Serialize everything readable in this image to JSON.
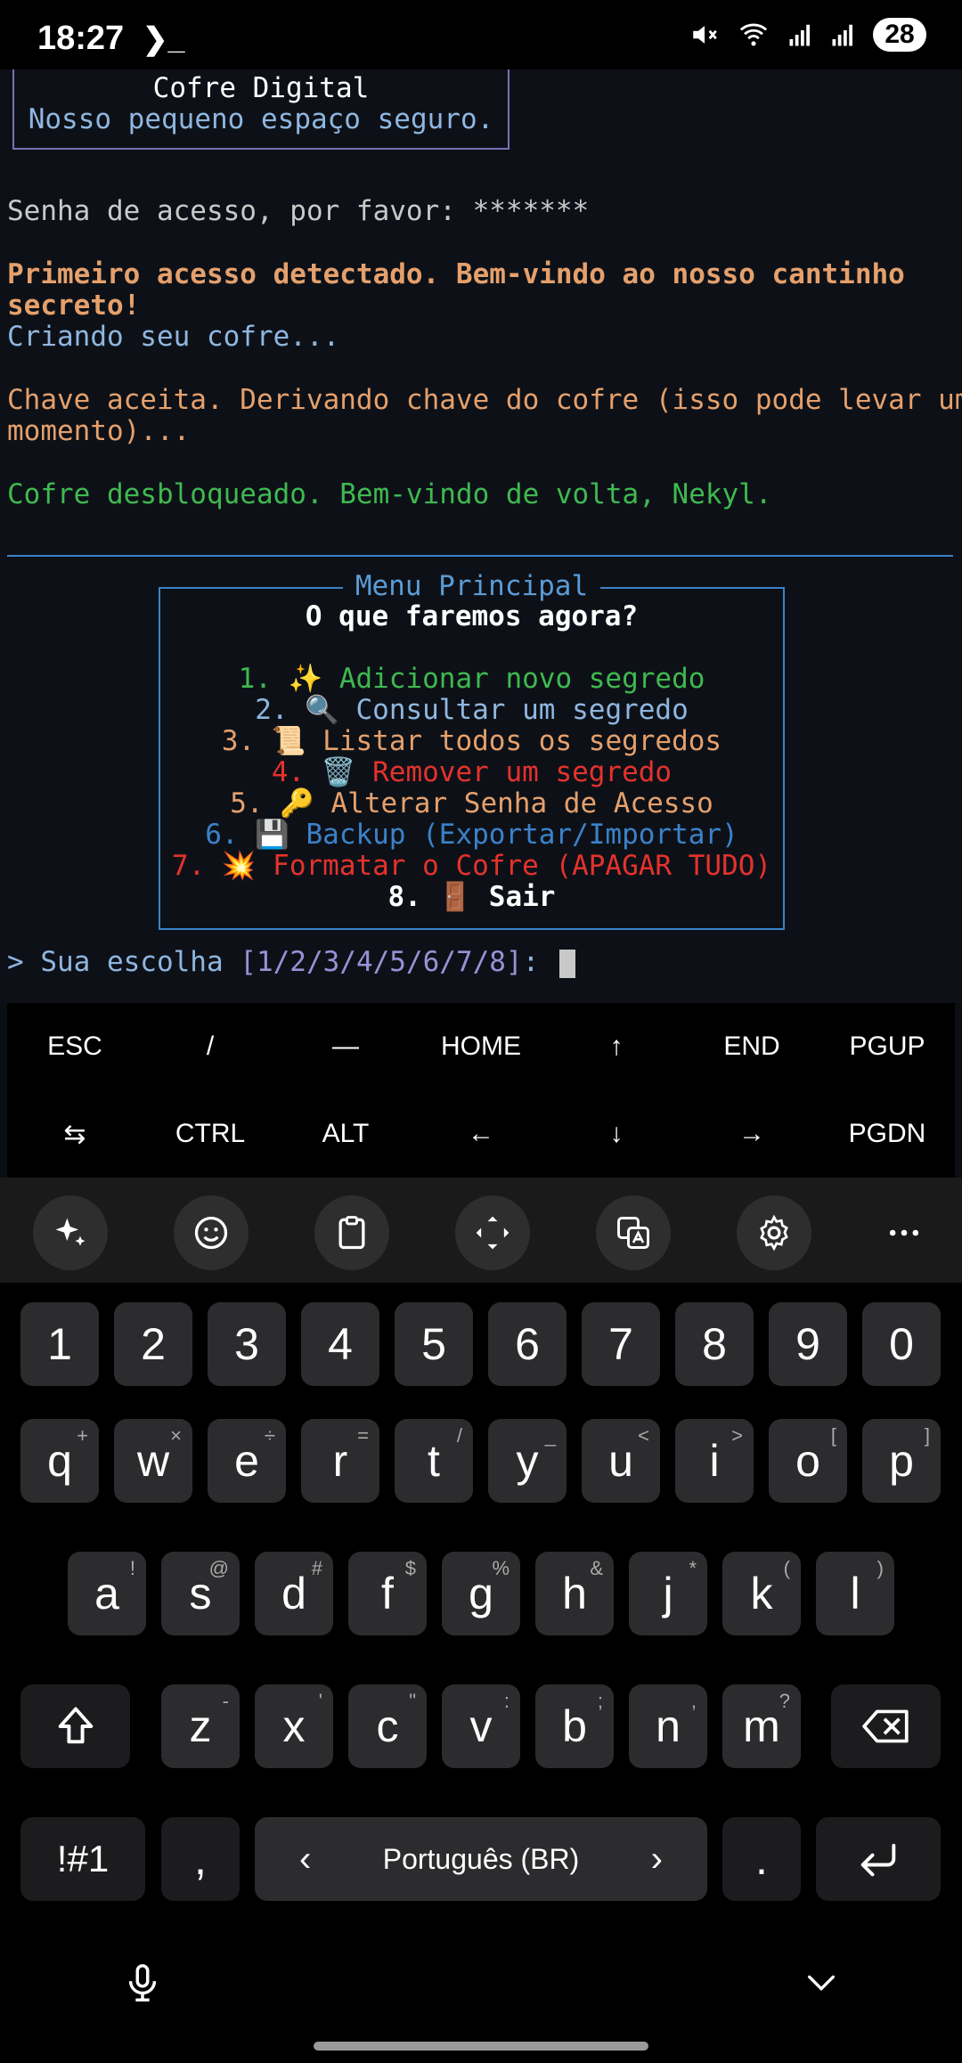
{
  "status_bar": {
    "time": "18:27",
    "prompt_glyph": "❯_",
    "battery": "28",
    "icons": [
      "mute-icon",
      "wifi-icon",
      "signal-icon",
      "signal-icon"
    ]
  },
  "terminal": {
    "header_title": "Cofre Digital",
    "header_subtitle": "Nosso pequeno espaço seguro.",
    "password_line": "Senha de acesso, por favor: *******",
    "first_access_line1": "Primeiro acesso detectado. Bem-vindo ao nosso cantinho",
    "first_access_line2": "secreto!",
    "creating": "Criando seu cofre...",
    "key_accepted_line1": "Chave aceita. Derivando chave do cofre (isso pode levar um",
    "key_accepted_line2": "momento)...",
    "unlocked": "Cofre desbloqueado. Bem-vindo de volta, Nekyl.",
    "menu_title": "Menu Principal",
    "menu_subtitle": "O que faremos agora?",
    "menu_items": [
      {
        "text": "1. ✨ Adicionar novo segredo",
        "color": "#3fb950"
      },
      {
        "text": "2. 🔍 Consultar um segredo",
        "color": "#8fb6e0"
      },
      {
        "text": "3. 📜 Listar todos os segredos",
        "color": "#e5a06c"
      },
      {
        "text": "4. 🗑️ Remover um segredo",
        "color": "#e5322d"
      },
      {
        "text": "5. 🔑 Alterar Senha de Acesso",
        "color": "#e5a06c"
      },
      {
        "text": "6. 💾 Backup (Exportar/Importar)",
        "color": "#3b82c9"
      },
      {
        "text": "7. 💥 Formatar o Cofre (APAGAR TUDO)",
        "color": "#e5322d"
      },
      {
        "text": "8. 🚪 Sair",
        "color": "#ffffff"
      }
    ],
    "prompt_prefix": "> Sua escolha ",
    "prompt_options": "[1/2/3/4/5/6/7/8]",
    "prompt_suffix": ":"
  },
  "extra_keys": {
    "row1": [
      "ESC",
      "/",
      "—",
      "HOME",
      "↑",
      "END",
      "PGUP"
    ],
    "row2": [
      "⇆",
      "CTRL",
      "ALT",
      "←",
      "↓",
      "→",
      "PGDN"
    ]
  },
  "keyboard": {
    "numbers": [
      "1",
      "2",
      "3",
      "4",
      "5",
      "6",
      "7",
      "8",
      "9",
      "0"
    ],
    "row_q": [
      [
        "q",
        "+"
      ],
      [
        "w",
        "×"
      ],
      [
        "e",
        "÷"
      ],
      [
        "r",
        "="
      ],
      [
        "t",
        "/"
      ],
      [
        "y",
        "_"
      ],
      [
        "u",
        "<"
      ],
      [
        "i",
        ">"
      ],
      [
        "o",
        "["
      ],
      [
        "p",
        "]"
      ]
    ],
    "row_a": [
      [
        "a",
        "!"
      ],
      [
        "s",
        "@"
      ],
      [
        "d",
        "#"
      ],
      [
        "f",
        "$"
      ],
      [
        "g",
        "%"
      ],
      [
        "h",
        "&"
      ],
      [
        "j",
        "*"
      ],
      [
        "k",
        "("
      ],
      [
        "l",
        ")"
      ]
    ],
    "row_z": [
      [
        "z",
        "-"
      ],
      [
        "x",
        "'"
      ],
      [
        "c",
        "\""
      ],
      [
        "v",
        ":"
      ],
      [
        "b",
        ";"
      ],
      [
        "n",
        ","
      ],
      [
        "m",
        "?"
      ]
    ],
    "symbols_key": "!#1",
    "comma": ",",
    "space_label": "Português (BR)",
    "period": "."
  },
  "colors": {
    "orange": "#e5a06c",
    "green": "#3fb950",
    "light_blue": "#8fb6e0",
    "blue": "#3b82c9",
    "red": "#e5322d",
    "purple": "#9d8fd8"
  }
}
